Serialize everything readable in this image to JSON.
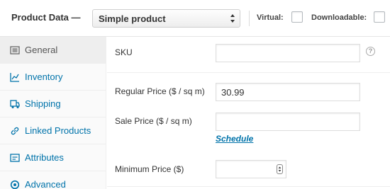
{
  "header": {
    "title": "Product Data —",
    "product_type": "Simple product",
    "virtual_label": "Virtual:",
    "downloadable_label": "Downloadable:"
  },
  "sidebar": {
    "items": [
      {
        "label": "General",
        "icon": "grid-icon",
        "active": true
      },
      {
        "label": "Inventory",
        "icon": "chart-icon",
        "active": false
      },
      {
        "label": "Shipping",
        "icon": "truck-icon",
        "active": false
      },
      {
        "label": "Linked Products",
        "icon": "link-icon",
        "active": false
      },
      {
        "label": "Attributes",
        "icon": "list-icon",
        "active": false
      },
      {
        "label": "Advanced",
        "icon": "gear-icon",
        "active": false
      }
    ]
  },
  "fields": {
    "sku_label": "SKU",
    "sku_value": "",
    "regular_price_label": "Regular Price ($ / sq m)",
    "regular_price_value": "30.99",
    "sale_price_label": "Sale Price ($ / sq m)",
    "sale_price_value": "",
    "schedule_link": "Schedule",
    "minimum_price_label": "Minimum Price ($)",
    "minimum_price_value": ""
  },
  "help_icon": "?",
  "colors": {
    "link": "#0073aa",
    "active_tab": "#eeeeee"
  }
}
